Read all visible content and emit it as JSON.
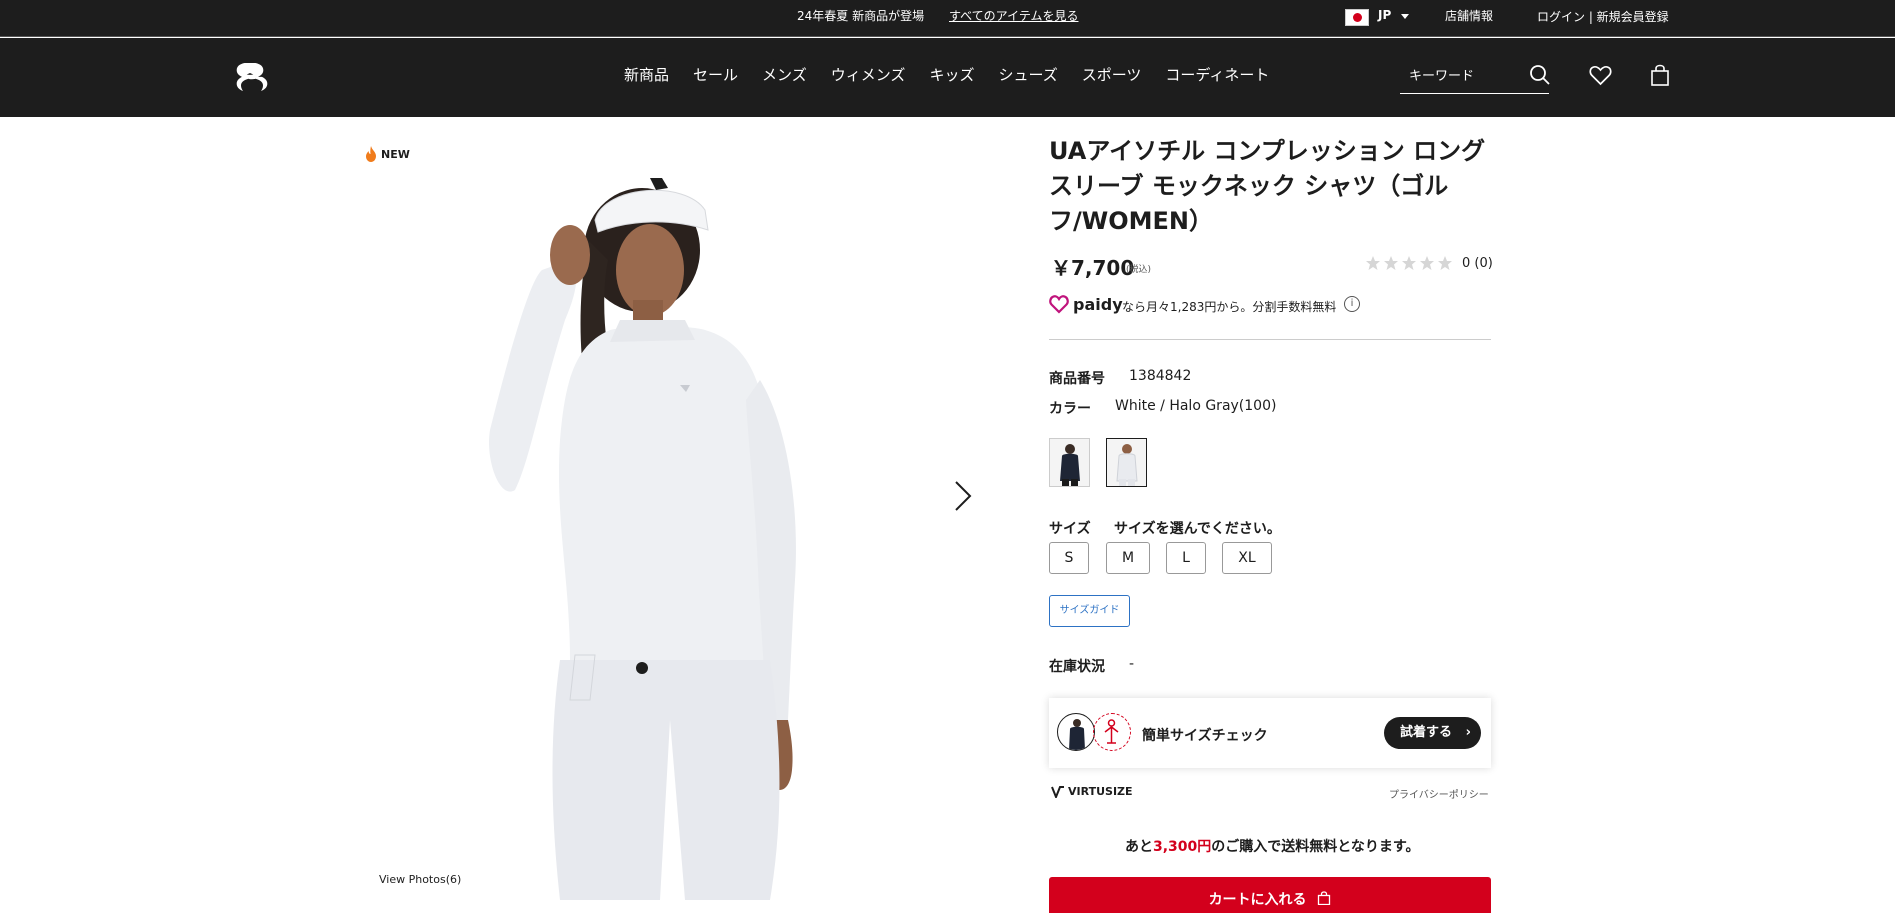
{
  "announcement": {
    "message": "24年春夏 新商品が登場",
    "link": "すべてのアイテムを見る",
    "country": "JP",
    "stores": "店舗情報",
    "login": "ログイン | 新規会員登録"
  },
  "nav": {
    "items": [
      "新商品",
      "セール",
      "メンズ",
      "ウィメンズ",
      "キッズ",
      "シューズ",
      "スポーツ",
      "コーディネート"
    ],
    "search_placeholder": "キーワード"
  },
  "gallery": {
    "badge": "NEW",
    "view_photos": "View Photos(6)"
  },
  "product": {
    "title": "UAアイソチル コンプレッション ロング スリーブ モックネック シャツ（ゴルフ/WOMEN）",
    "price": "￥7,700",
    "tax_note": "(税込)",
    "rating": 0,
    "rating_count": "0 (0)",
    "paidy_brand": "paidy",
    "paidy_text": "なら月々1,283円から。分割手数料無料",
    "product_number_label": "商品番号",
    "product_number": "1384842",
    "color_label": "カラー",
    "color_value": "White / Halo Gray(100)",
    "colors": [
      "Black",
      "White / Halo Gray(100)"
    ],
    "size_label": "サイズ",
    "size_prompt": "サイズを選んでください。",
    "sizes": [
      "S",
      "M",
      "L",
      "XL"
    ],
    "size_guide": "サイズガイド",
    "stock_label": "在庫状況",
    "stock_value": "-"
  },
  "virtusize": {
    "label": "簡単サイズチェック",
    "button": "試着する",
    "brand": "VIRTUSIZE",
    "privacy": "プライバシーポリシー"
  },
  "shipping": {
    "prefix": "あと",
    "amount": "3,300円",
    "suffix": "のご購入で送料無料となります。"
  },
  "cart": {
    "button": "カートに入れる"
  },
  "colors": {
    "header_bg": "#1d1d1d",
    "accent_red": "#d3001c",
    "link_blue": "#2d72c4"
  }
}
